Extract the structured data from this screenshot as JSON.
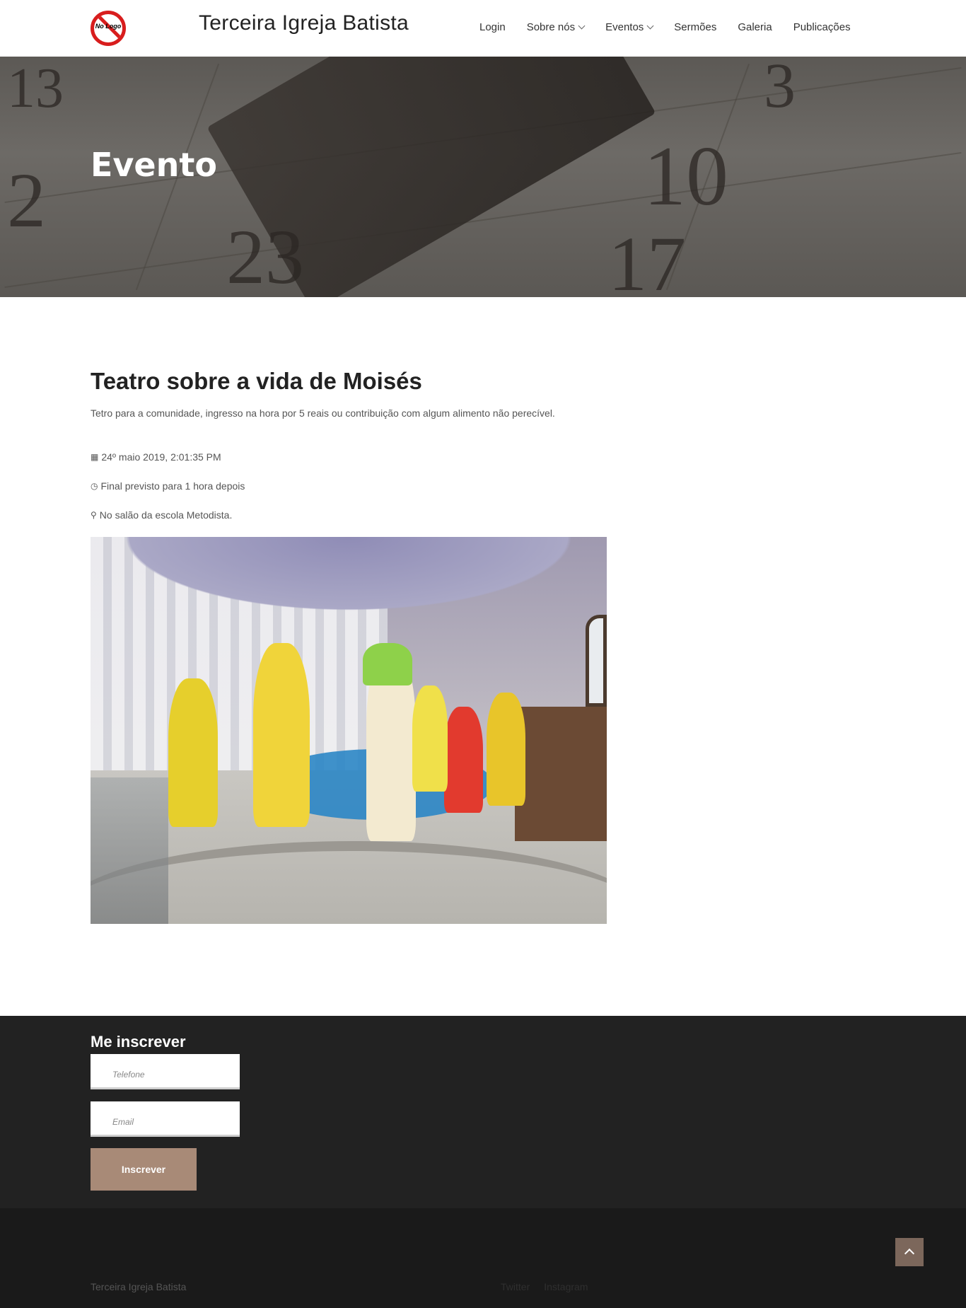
{
  "header": {
    "logo_text": "No Logo",
    "brand": "Terceira Igreja Batista",
    "nav": [
      {
        "label": "Login"
      },
      {
        "label": "Sobre nós"
      },
      {
        "label": "Eventos"
      },
      {
        "label": "Sermões"
      },
      {
        "label": "Galeria"
      },
      {
        "label": "Publicações"
      }
    ]
  },
  "hero": {
    "title": "Evento",
    "numbers": [
      "3",
      "10",
      "2",
      "23",
      "17",
      "13"
    ]
  },
  "event": {
    "title": "Teatro sobre a vida de Moisés",
    "description": "Tetro para a comunidade, ingresso na hora por 5 reais ou contribuição com algum alimento não perecível.",
    "date": "24º maio 2019, 2:01:35 PM",
    "end": "Final previsto para 1 hora depois",
    "place": "No salão da escola Metodista."
  },
  "subscribe": {
    "title": "Me inscrever",
    "phone_placeholder": "Telefone",
    "email_placeholder": "Email",
    "button": "Inscrever"
  },
  "footer": {
    "copyright": "Terceira Igreja Batista",
    "social": [
      "Twitter",
      "Instagram"
    ]
  },
  "colors": {
    "accent": "#a88a77",
    "footer_bg": "#222222",
    "bottom_bg": "#1a1a1a",
    "logo_red": "#d81d1d"
  },
  "icons": {
    "date": "calendar-icon",
    "end": "clock-icon",
    "place": "map-marker-icon",
    "back_to_top": "chevron-up-icon"
  }
}
